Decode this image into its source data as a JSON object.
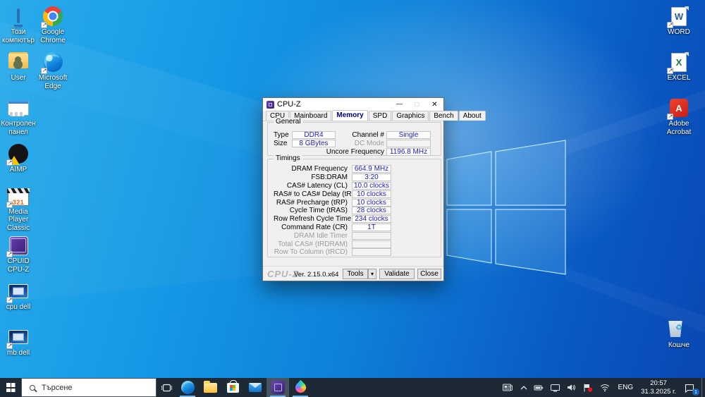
{
  "desktop": {
    "left_col1": [
      {
        "label": "Този компютър",
        "kind": "this-pc",
        "shortcut": false
      },
      {
        "label": "User",
        "kind": "user-folder",
        "shortcut": false
      },
      {
        "label": "Контролен панел",
        "kind": "control-panel",
        "shortcut": false
      },
      {
        "label": "AIMP",
        "kind": "aimp",
        "shortcut": true
      },
      {
        "label": "Media Player Classic",
        "kind": "mpc",
        "shortcut": true
      },
      {
        "label": "CPUID CPU-Z",
        "kind": "cpuz",
        "shortcut": true
      },
      {
        "label": "cpu dell",
        "kind": "photo",
        "shortcut": true
      },
      {
        "label": "mb dell",
        "kind": "photo",
        "shortcut": true
      }
    ],
    "left_col2": [
      {
        "label": "Google Chrome",
        "kind": "chrome",
        "shortcut": true
      },
      {
        "label": "Microsoft Edge",
        "kind": "edge",
        "shortcut": true
      }
    ],
    "right_col": [
      {
        "label": "WORD",
        "kind": "word",
        "shortcut": true
      },
      {
        "label": "EXCEL",
        "kind": "excel",
        "shortcut": true
      },
      {
        "label": "Adobe Acrobat",
        "kind": "acrobat",
        "shortcut": true
      }
    ],
    "recycle_label": "Кошче"
  },
  "cpuz": {
    "title": "CPU-Z",
    "tabs": [
      {
        "label": "CPU"
      },
      {
        "label": "Mainboard"
      },
      {
        "label": "Memory",
        "active": true
      },
      {
        "label": "SPD"
      },
      {
        "label": "Graphics"
      },
      {
        "label": "Bench"
      },
      {
        "label": "About"
      }
    ],
    "general": {
      "label": "General",
      "left_rows": [
        {
          "label": "Type",
          "value": "DDR4"
        },
        {
          "label": "Size",
          "value": "8 GBytes"
        }
      ],
      "right_rows": [
        {
          "label": "Channel #",
          "value": "Single"
        },
        {
          "label": "DC Mode",
          "value": "",
          "disabled": true
        },
        {
          "label": "Uncore Frequency",
          "value": "1196.8 MHz"
        }
      ]
    },
    "timings": {
      "label": "Timings",
      "rows": [
        {
          "label": "DRAM Frequency",
          "value": "664.9 MHz"
        },
        {
          "label": "FSB:DRAM",
          "value": "3:20"
        },
        {
          "label": "CAS# Latency (CL)",
          "value": "10.0 clocks"
        },
        {
          "label": "RAS# to CAS# Delay (tRCD)",
          "value": "10 clocks"
        },
        {
          "label": "RAS# Precharge (tRP)",
          "value": "10 clocks"
        },
        {
          "label": "Cycle Time (tRAS)",
          "value": "28 clocks"
        },
        {
          "label": "Row Refresh Cycle Time (tRFC)",
          "value": "234 clocks"
        },
        {
          "label": "Command Rate (CR)",
          "value": "1T"
        },
        {
          "label": "DRAM Idle Timer",
          "value": "",
          "disabled": true
        },
        {
          "label": "Total CAS# (tRDRAM)",
          "value": "",
          "disabled": true
        },
        {
          "label": "Row To Column (tRCD)",
          "value": "",
          "disabled": true
        }
      ]
    },
    "footer": {
      "logo": "CPU-Z",
      "version": "Ver. 2.15.0.x64",
      "tools_label": "Tools",
      "validate_label": "Validate",
      "close_label": "Close"
    }
  },
  "taskbar": {
    "search_placeholder": "Търсене",
    "apps": [
      {
        "kind": "t-edge",
        "name": "microsoft-edge",
        "running": true
      },
      {
        "kind": "t-explorer",
        "name": "file-explorer"
      },
      {
        "kind": "t-store",
        "name": "microsoft-store"
      },
      {
        "kind": "t-mail",
        "name": "mail"
      },
      {
        "kind": "t-cpuz",
        "name": "cpu-z",
        "running": true,
        "active": true
      },
      {
        "kind": "t-aimp",
        "name": "aimp",
        "running": true
      }
    ],
    "tray": {
      "language": "ENG",
      "time": "20:57",
      "date": "31.3.2025 г.",
      "notification_count": "1"
    }
  },
  "colors": {
    "accent_navy_value": "#2323b2",
    "taskbar": "#1e2936",
    "active_tab_text": "#000080",
    "running_underline": "#76b9e8",
    "alert_red": "#e81123"
  }
}
